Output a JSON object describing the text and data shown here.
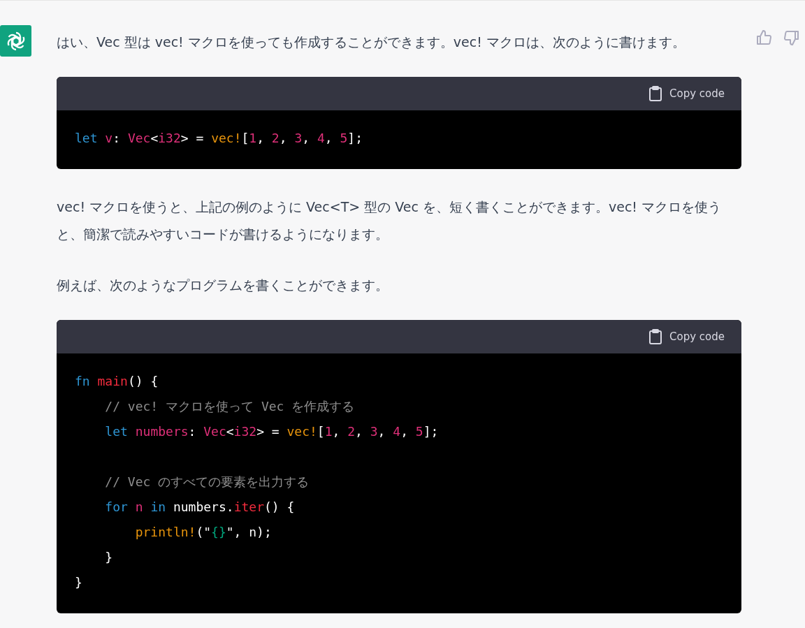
{
  "message": {
    "blocks": [
      {
        "kind": "paragraph",
        "text": "はい、Vec 型は vec! マクロを使っても作成することができます。vec! マクロは、次のように書けます。"
      },
      {
        "kind": "code",
        "copy_label": "Copy code",
        "lines": [
          {
            "kind": "code",
            "tokens": [
              {
                "text": "let ",
                "kind": "keyword"
              },
              {
                "text": "v",
                "kind": "variable"
              },
              {
                "text": ": ",
                "kind": "plain"
              },
              {
                "text": "Vec",
                "kind": "type"
              },
              {
                "text": "<",
                "kind": "plain"
              },
              {
                "text": "i32",
                "kind": "type"
              },
              {
                "text": "> = ",
                "kind": "plain"
              },
              {
                "text": "vec!",
                "kind": "macro"
              },
              {
                "text": "[",
                "kind": "plain"
              },
              {
                "text": "1",
                "kind": "number"
              },
              {
                "text": ", ",
                "kind": "plain"
              },
              {
                "text": "2",
                "kind": "number"
              },
              {
                "text": ", ",
                "kind": "plain"
              },
              {
                "text": "3",
                "kind": "number"
              },
              {
                "text": ", ",
                "kind": "plain"
              },
              {
                "text": "4",
                "kind": "number"
              },
              {
                "text": ", ",
                "kind": "plain"
              },
              {
                "text": "5",
                "kind": "number"
              },
              {
                "text": "];",
                "kind": "plain"
              }
            ]
          }
        ]
      },
      {
        "kind": "paragraph",
        "text": "vec! マクロを使うと、上記の例のように Vec<T> 型の Vec を、短く書くことができます。vec! マクロを使うと、簡潔で読みやすいコードが書けるようになります。"
      },
      {
        "kind": "paragraph",
        "text": "例えば、次のようなプログラムを書くことができます。"
      },
      {
        "kind": "code",
        "copy_label": "Copy code",
        "lines": [
          {
            "kind": "code",
            "tokens": [
              {
                "text": "fn ",
                "kind": "keyword"
              },
              {
                "text": "main",
                "kind": "function"
              },
              {
                "text": "() {",
                "kind": "plain"
              }
            ]
          },
          {
            "kind": "code",
            "tokens": [
              {
                "text": "    // vec! マクロを使って Vec を作成する",
                "kind": "comment"
              }
            ]
          },
          {
            "kind": "code",
            "tokens": [
              {
                "text": "    let ",
                "kind": "keyword"
              },
              {
                "text": "numbers",
                "kind": "variable"
              },
              {
                "text": ": ",
                "kind": "plain"
              },
              {
                "text": "Vec",
                "kind": "type"
              },
              {
                "text": "<",
                "kind": "plain"
              },
              {
                "text": "i32",
                "kind": "type"
              },
              {
                "text": "> = ",
                "kind": "plain"
              },
              {
                "text": "vec!",
                "kind": "macro"
              },
              {
                "text": "[",
                "kind": "plain"
              },
              {
                "text": "1",
                "kind": "number"
              },
              {
                "text": ", ",
                "kind": "plain"
              },
              {
                "text": "2",
                "kind": "number"
              },
              {
                "text": ", ",
                "kind": "plain"
              },
              {
                "text": "3",
                "kind": "number"
              },
              {
                "text": ", ",
                "kind": "plain"
              },
              {
                "text": "4",
                "kind": "number"
              },
              {
                "text": ", ",
                "kind": "plain"
              },
              {
                "text": "5",
                "kind": "number"
              },
              {
                "text": "];",
                "kind": "plain"
              }
            ]
          },
          {
            "kind": "blank"
          },
          {
            "kind": "code",
            "tokens": [
              {
                "text": "    // Vec のすべての要素を出力する",
                "kind": "comment"
              }
            ]
          },
          {
            "kind": "code",
            "tokens": [
              {
                "text": "    for ",
                "kind": "keyword"
              },
              {
                "text": "n ",
                "kind": "variable"
              },
              {
                "text": "in",
                "kind": "keyword"
              },
              {
                "text": " numbers.",
                "kind": "plain"
              },
              {
                "text": "iter",
                "kind": "function"
              },
              {
                "text": "() {",
                "kind": "plain"
              }
            ]
          },
          {
            "kind": "code",
            "tokens": [
              {
                "text": "        println!",
                "kind": "macro"
              },
              {
                "text": "(\"",
                "kind": "plain"
              },
              {
                "text": "{}",
                "kind": "string"
              },
              {
                "text": "\", n);",
                "kind": "plain"
              }
            ]
          },
          {
            "kind": "code",
            "tokens": [
              {
                "text": "    }",
                "kind": "plain"
              }
            ]
          },
          {
            "kind": "code",
            "tokens": [
              {
                "text": "}",
                "kind": "plain"
              }
            ]
          }
        ]
      }
    ]
  }
}
